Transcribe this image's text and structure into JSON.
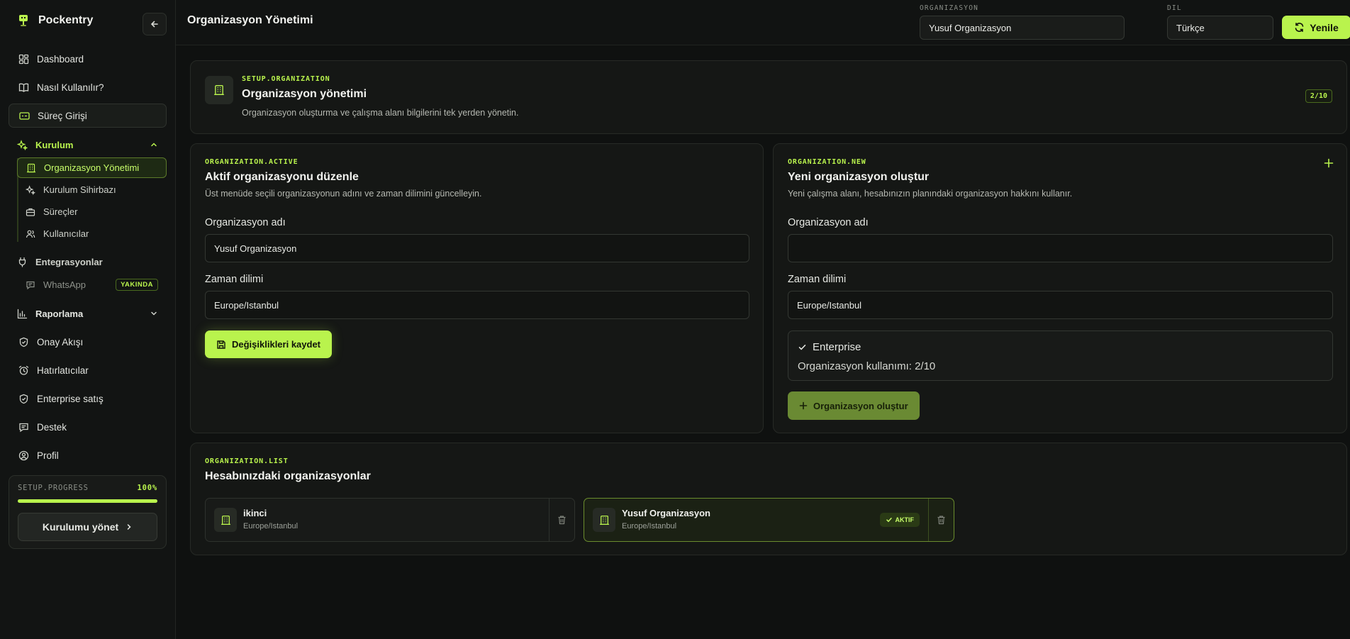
{
  "brand": {
    "name": "Pockentry"
  },
  "sidebar": {
    "items_top": [
      {
        "label": "Dashboard",
        "icon": "dashboard-grid-icon"
      },
      {
        "label": "Nasıl Kullanılır?",
        "icon": "book-icon"
      },
      {
        "label": "Süreç Girişi",
        "icon": "terminal-box-icon"
      }
    ],
    "setup": {
      "label": "Kurulum",
      "children": [
        {
          "label": "Organizasyon Yönetimi",
          "active": true
        },
        {
          "label": "Kurulum Sihirbazı"
        },
        {
          "label": "Süreçler"
        },
        {
          "label": "Kullanıcılar"
        }
      ]
    },
    "integrations": {
      "label": "Entegrasyonlar",
      "children": [
        {
          "label": "WhatsApp",
          "badge": "YAKINDA"
        }
      ]
    },
    "reporting": {
      "label": "Raporlama"
    },
    "items_bottom": [
      {
        "label": "Onay Akışı",
        "icon": "shield-check-icon"
      },
      {
        "label": "Hatırlatıcılar",
        "icon": "alarm-clock-icon"
      },
      {
        "label": "Enterprise satış",
        "icon": "shield-check-icon"
      },
      {
        "label": "Destek",
        "icon": "chat-icon"
      },
      {
        "label": "Profil",
        "icon": "user-circle-icon"
      }
    ],
    "progress": {
      "label": "SETUP.PROGRESS",
      "value_label": "100%",
      "fraction": 1.0,
      "button": "Kurulumu yönet"
    }
  },
  "header": {
    "title": "Organizasyon Yönetimi",
    "org_label": "ORGANIZASYON",
    "org_value": "Yusuf Organizasyon",
    "lang_label": "DIL",
    "lang_value": "Türkçe",
    "refresh": "Yenile"
  },
  "intro": {
    "tag": "SETUP.ORGANIZATION",
    "title": "Organizasyon yönetimi",
    "desc": "Organizasyon oluşturma ve çalışma alanı bilgilerini tek yerden yönetin.",
    "step": "2/10"
  },
  "active_card": {
    "tag": "ORGANIZATION.ACTIVE",
    "title": "Aktif organizasyonu düzenle",
    "desc": "Üst menüde seçili organizasyonun adını ve zaman dilimini güncelleyin.",
    "name_label": "Organizasyon adı",
    "name_value": "Yusuf Organizasyon",
    "tz_label": "Zaman dilimi",
    "tz_value": "Europe/Istanbul",
    "save": "Değişiklikleri kaydet"
  },
  "new_card": {
    "tag": "ORGANIZATION.NEW",
    "title": "Yeni organizasyon oluştur",
    "desc": "Yeni çalışma alanı, hesabınızın planındaki organizasyon hakkını kullanır.",
    "name_label": "Organizasyon adı",
    "name_value": "",
    "tz_label": "Zaman dilimi",
    "tz_value": "Europe/Istanbul",
    "plan": "Enterprise",
    "usage": "Organizasyon kullanımı: 2/10",
    "create": "Organizasyon oluştur"
  },
  "list_card": {
    "tag": "ORGANIZATION.LIST",
    "title": "Hesabınızdaki organizasyonlar",
    "orgs": [
      {
        "name": "ikinci",
        "tz": "Europe/Istanbul",
        "active": false
      },
      {
        "name": "Yusuf Organizasyon",
        "tz": "Europe/Istanbul",
        "active": true,
        "badge": "AKTIF"
      }
    ]
  },
  "colors": {
    "accent": "#b9f34d",
    "background": "#0f1110",
    "panel": "#151715"
  }
}
